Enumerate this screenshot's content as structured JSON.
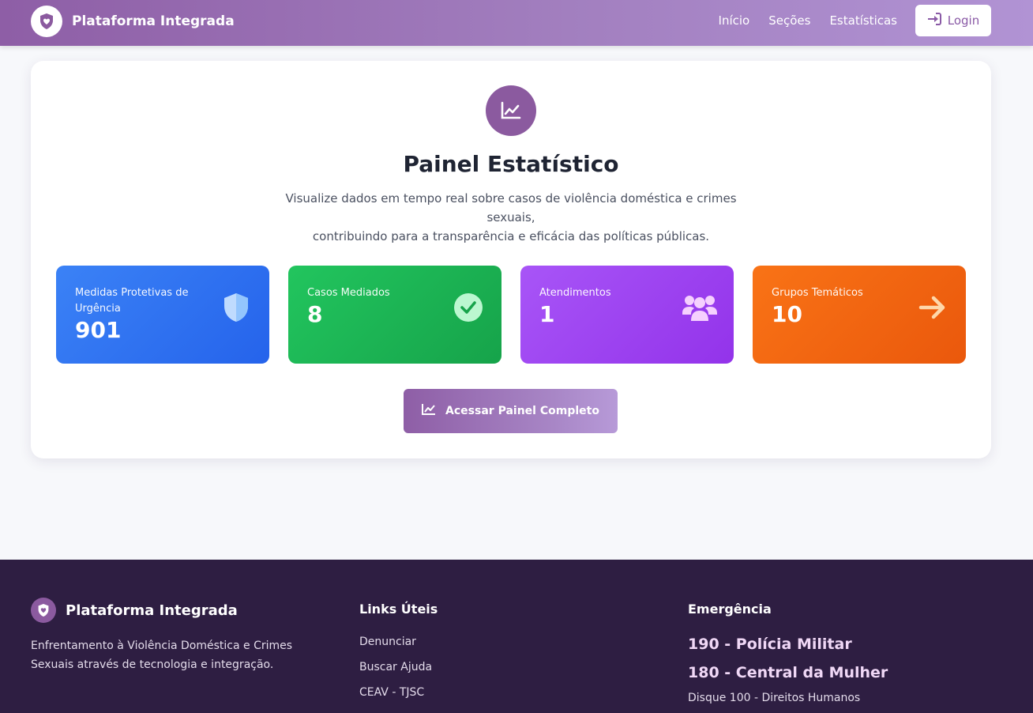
{
  "navbar": {
    "brand": "Plataforma Integrada",
    "links": [
      "Início",
      "Seções",
      "Estatísticas"
    ],
    "login_label": "Login"
  },
  "hero": {
    "title": "Painel Estatístico",
    "subtitle_line1": "Visualize dados em tempo real sobre casos de violência doméstica e crimes sexuais,",
    "subtitle_line2": "contribuindo para a transparência e eficácia das políticas públicas."
  },
  "stats": [
    {
      "label": "Medidas Protetivas de Urgência",
      "value": "901",
      "icon": "shield-icon",
      "color": "#3b82f6"
    },
    {
      "label": "Casos Mediados",
      "value": "8",
      "icon": "check-circle-icon",
      "color": "#22c55e"
    },
    {
      "label": "Atendimentos",
      "value": "1",
      "icon": "users-icon",
      "color": "#a855f7"
    },
    {
      "label": "Grupos Temáticos",
      "value": "10",
      "icon": "arrow-right-icon",
      "color": "#f97316"
    }
  ],
  "cta_label": "Acessar Painel Completo",
  "footer": {
    "brand": "Plataforma Integrada",
    "description": "Enfrentamento à Violência Doméstica e Crimes Sexuais através de tecnologia e integração.",
    "links_title": "Links Úteis",
    "links": [
      "Denunciar",
      "Buscar Ajuda",
      "CEAV - TJSC"
    ],
    "emergency_title": "Emergência",
    "emergency": [
      "190 - Polícia Militar",
      "180 - Central da Mulher"
    ],
    "emergency_small": "Disque 100 - Direitos Humanos"
  },
  "colors": {
    "brand": "#8b5a9f",
    "footer_bg": "#2e1e42"
  }
}
